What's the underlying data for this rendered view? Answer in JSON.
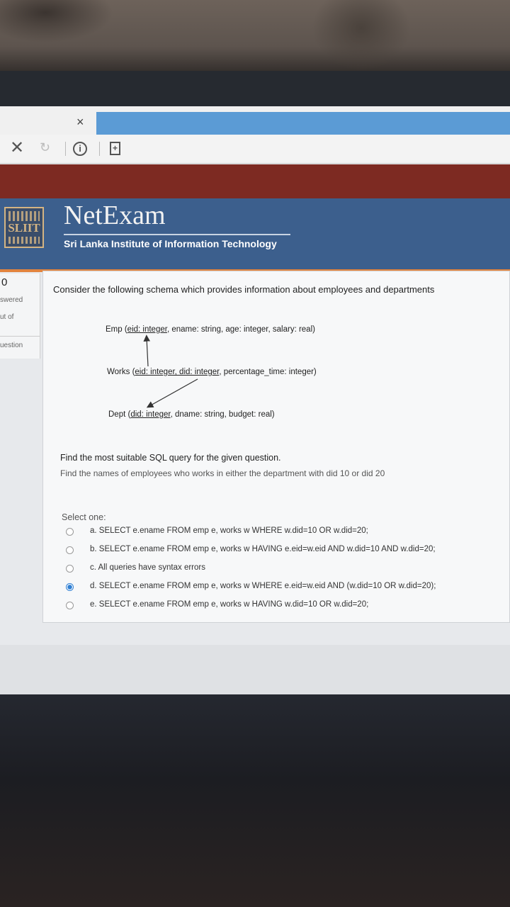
{
  "browser": {
    "tab_close": "×",
    "stop_icon": "✕",
    "reload_icon": "↻",
    "info_icon": "i",
    "page_icon": "+"
  },
  "site": {
    "logo_text": "SLIIT",
    "title": "NetExam",
    "subtitle": "Sri Lanka Institute of Information Technology"
  },
  "nav": {
    "count": "0",
    "answered": "swered",
    "out_of": "ut of",
    "question": "uestion"
  },
  "question": {
    "prompt": "Consider the following schema which provides information about employees and departments",
    "schema": {
      "emp_name": "Emp (",
      "emp_key": "eid: integer",
      "emp_rest": ", ename: string, age: integer, salary: real)",
      "works_name": "Works (",
      "works_key": "eid: integer, did: integer",
      "works_rest": ", percentage_time: integer)",
      "dept_name": "Dept (",
      "dept_key": "did: integer",
      "dept_rest": ", dname: string, budget: real)"
    },
    "find_heading": "Find the most suitable SQL query for the given question.",
    "find_text": "Find the names of employees who works in either the department with did 10 or did 20",
    "select_one": "Select one:",
    "options": [
      {
        "label": "a. SELECT e.ename FROM emp e, works w WHERE w.did=10 OR w.did=20;",
        "checked": false
      },
      {
        "label": "b. SELECT e.ename FROM emp e, works w HAVING e.eid=w.eid AND w.did=10 AND w.did=20;",
        "checked": false
      },
      {
        "label": "c. All queries have syntax errors",
        "checked": false
      },
      {
        "label": "d. SELECT e.ename FROM emp e, works w WHERE e.eid=w.eid AND (w.did=10 OR w.did=20);",
        "checked": true
      },
      {
        "label": "e. SELECT e.ename FROM emp e, works w HAVING w.did=10 OR w.did=20;",
        "checked": false
      }
    ]
  },
  "colors": {
    "header_blue": "#3c5f8d",
    "header_red": "#7d2a22",
    "accent_orange": "#e2843e",
    "radio_selected": "#2f7fd3"
  }
}
